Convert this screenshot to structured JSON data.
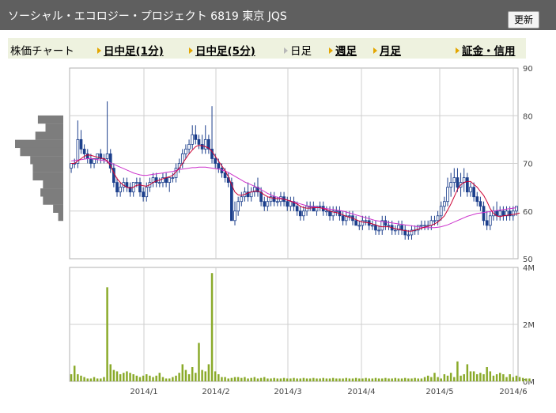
{
  "header": {
    "title": "ソーシャル・エコロジー・プロジェクト 6819 東京 JQS",
    "refresh_label": "更新"
  },
  "tabs": [
    {
      "label": "株価チャート",
      "kind": "heading"
    },
    {
      "label": "日中足(1分)",
      "kind": "link"
    },
    {
      "label": "日中足(5分)",
      "kind": "link"
    },
    {
      "label": "日足",
      "kind": "current"
    },
    {
      "label": "週足",
      "kind": "link"
    },
    {
      "label": "月足",
      "kind": "link"
    },
    {
      "label": "証金・信用",
      "kind": "link"
    }
  ],
  "colors": {
    "candle": "#1c3f8c",
    "ma_short": "#cc0033",
    "ma_long": "#cc33cc",
    "volume": "#8aaa2a",
    "profile": "#7d7d7d",
    "grid": "#cfcfcf",
    "frame": "#b0b0b0",
    "header_bg": "#5f5f5f",
    "tab_bg": "#eef2df"
  },
  "chart_data": [
    {
      "type": "candlestick",
      "yticks": [
        "90",
        "80",
        "70",
        "60",
        "50"
      ],
      "ylim": [
        50,
        90
      ],
      "xticks": [
        "2014/1",
        "2014/2",
        "2014/3",
        "2014/4",
        "2014/5",
        "2014/6"
      ],
      "candles": [
        [
          69,
          70,
          68,
          70
        ],
        [
          70,
          71,
          69,
          70
        ],
        [
          70,
          79,
          69,
          75
        ],
        [
          75,
          77,
          72,
          73
        ],
        [
          73,
          74,
          71,
          72
        ],
        [
          72,
          73,
          70,
          71
        ],
        [
          71,
          72,
          69,
          70
        ],
        [
          70,
          71,
          69,
          71
        ],
        [
          71,
          72,
          70,
          72
        ],
        [
          72,
          73,
          70,
          71
        ],
        [
          71,
          72,
          70,
          71
        ],
        [
          71,
          83,
          70,
          72
        ],
        [
          72,
          73,
          68,
          69
        ],
        [
          69,
          70,
          65,
          66
        ],
        [
          66,
          67,
          63,
          64
        ],
        [
          64,
          66,
          63,
          65
        ],
        [
          65,
          67,
          64,
          66
        ],
        [
          66,
          67,
          64,
          65
        ],
        [
          65,
          66,
          63,
          64
        ],
        [
          64,
          66,
          63,
          66
        ],
        [
          66,
          67,
          65,
          66
        ],
        [
          66,
          67,
          63,
          64
        ],
        [
          64,
          65,
          62,
          63
        ],
        [
          63,
          66,
          62,
          65
        ],
        [
          65,
          67,
          64,
          66
        ],
        [
          66,
          68,
          65,
          67
        ],
        [
          67,
          68,
          65,
          66
        ],
        [
          66,
          67,
          65,
          66
        ],
        [
          66,
          68,
          65,
          67
        ],
        [
          67,
          68,
          65,
          66
        ],
        [
          66,
          67,
          64,
          67
        ],
        [
          67,
          68,
          66,
          67
        ],
        [
          67,
          70,
          66,
          69
        ],
        [
          69,
          71,
          68,
          70
        ],
        [
          70,
          73,
          69,
          72
        ],
        [
          72,
          74,
          71,
          73
        ],
        [
          73,
          75,
          72,
          74
        ],
        [
          74,
          78,
          73,
          76
        ],
        [
          76,
          78,
          74,
          75
        ],
        [
          75,
          76,
          73,
          74
        ],
        [
          74,
          76,
          72,
          73
        ],
        [
          73,
          78,
          72,
          75
        ],
        [
          75,
          76,
          72,
          73
        ],
        [
          73,
          82,
          70,
          71
        ],
        [
          71,
          72,
          69,
          70
        ],
        [
          70,
          71,
          68,
          69
        ],
        [
          69,
          70,
          67,
          68
        ],
        [
          68,
          69,
          66,
          67
        ],
        [
          67,
          68,
          65,
          66
        ],
        [
          66,
          67,
          59,
          58
        ],
        [
          58,
          62,
          57,
          60
        ],
        [
          60,
          63,
          59,
          62
        ],
        [
          62,
          64,
          61,
          63
        ],
        [
          63,
          65,
          62,
          64
        ],
        [
          64,
          66,
          62,
          63
        ],
        [
          63,
          65,
          62,
          64
        ],
        [
          64,
          66,
          63,
          65
        ],
        [
          65,
          67,
          63,
          64
        ],
        [
          64,
          65,
          61,
          62
        ],
        [
          62,
          63,
          60,
          61
        ],
        [
          61,
          63,
          60,
          62
        ],
        [
          62,
          64,
          61,
          63
        ],
        [
          63,
          64,
          61,
          62
        ],
        [
          62,
          63,
          61,
          62
        ],
        [
          62,
          64,
          61,
          63
        ],
        [
          63,
          64,
          61,
          62
        ],
        [
          62,
          63,
          60,
          61
        ],
        [
          61,
          63,
          60,
          62
        ],
        [
          62,
          63,
          60,
          61
        ],
        [
          61,
          62,
          59,
          60
        ],
        [
          60,
          61,
          58,
          59
        ],
        [
          59,
          61,
          58,
          60
        ],
        [
          60,
          62,
          59,
          61
        ],
        [
          61,
          62,
          60,
          61
        ],
        [
          61,
          62,
          60,
          60
        ],
        [
          60,
          61,
          59,
          61
        ],
        [
          61,
          62,
          60,
          61
        ],
        [
          61,
          62,
          59,
          60
        ],
        [
          60,
          61,
          59,
          60
        ],
        [
          60,
          61,
          58,
          59
        ],
        [
          59,
          61,
          58,
          60
        ],
        [
          60,
          61,
          59,
          60
        ],
        [
          60,
          61,
          58,
          59
        ],
        [
          59,
          60,
          57,
          58
        ],
        [
          58,
          60,
          57,
          59
        ],
        [
          59,
          60,
          58,
          59
        ],
        [
          59,
          60,
          57,
          58
        ],
        [
          58,
          59,
          57,
          57
        ],
        [
          57,
          58,
          56,
          57
        ],
        [
          57,
          59,
          56,
          58
        ],
        [
          58,
          59,
          57,
          58
        ],
        [
          58,
          59,
          56,
          57
        ],
        [
          57,
          58,
          56,
          57
        ],
        [
          57,
          58,
          55,
          56
        ],
        [
          56,
          57,
          55,
          56
        ],
        [
          56,
          59,
          55,
          58
        ],
        [
          58,
          59,
          56,
          57
        ],
        [
          57,
          58,
          56,
          57
        ],
        [
          57,
          58,
          55,
          56
        ],
        [
          56,
          57,
          55,
          56
        ],
        [
          56,
          58,
          55,
          57
        ],
        [
          57,
          58,
          55,
          56
        ],
        [
          56,
          57,
          54,
          55
        ],
        [
          55,
          56,
          54,
          55
        ],
        [
          55,
          57,
          54,
          56
        ],
        [
          56,
          57,
          55,
          56
        ],
        [
          56,
          57,
          55,
          57
        ],
        [
          57,
          58,
          56,
          57
        ],
        [
          57,
          58,
          56,
          57
        ],
        [
          57,
          58,
          56,
          57
        ],
        [
          57,
          59,
          56,
          58
        ],
        [
          58,
          59,
          57,
          58
        ],
        [
          58,
          60,
          57,
          59
        ],
        [
          59,
          62,
          58,
          61
        ],
        [
          61,
          63,
          60,
          62
        ],
        [
          62,
          67,
          61,
          65
        ],
        [
          65,
          68,
          63,
          66
        ],
        [
          66,
          69,
          64,
          67
        ],
        [
          67,
          69,
          64,
          65
        ],
        [
          65,
          68,
          63,
          66
        ],
        [
          66,
          69,
          64,
          67
        ],
        [
          67,
          68,
          63,
          64
        ],
        [
          64,
          66,
          63,
          65
        ],
        [
          65,
          66,
          62,
          63
        ],
        [
          63,
          64,
          61,
          62
        ],
        [
          62,
          63,
          60,
          61
        ],
        [
          61,
          62,
          57,
          58
        ],
        [
          58,
          60,
          56,
          57
        ],
        [
          57,
          60,
          56,
          59
        ],
        [
          59,
          61,
          58,
          60
        ],
        [
          60,
          62,
          58,
          59
        ],
        [
          59,
          61,
          58,
          60
        ],
        [
          60,
          61,
          58,
          59
        ],
        [
          59,
          61,
          58,
          60
        ],
        [
          60,
          61,
          58,
          59
        ],
        [
          59,
          61,
          58,
          60
        ],
        [
          60,
          61,
          59,
          61
        ]
      ],
      "ma_short": [
        70,
        70,
        70.5,
        71,
        71.5,
        71.8,
        71.7,
        71.5,
        71.3,
        71.1,
        71,
        70.5,
        69.5,
        68,
        66.8,
        66,
        65.4,
        65,
        64.8,
        65,
        65.4,
        65.5,
        65.3,
        65.2,
        65.5,
        66,
        66.3,
        66.5,
        66.8,
        67,
        67.2,
        67.5,
        68.2,
        69,
        70,
        71,
        72,
        72.8,
        73.5,
        73.8,
        73.7,
        73.5,
        73.2,
        72.5,
        71.5,
        70.5,
        69.5,
        68.5,
        67.2,
        65.5,
        64,
        63.4,
        63.3,
        63.5,
        63.8,
        64,
        64.2,
        64.2,
        63.9,
        63.4,
        63,
        62.8,
        62.7,
        62.6,
        62.6,
        62.5,
        62.3,
        62.1,
        61.8,
        61.5,
        61,
        60.7,
        60.6,
        60.6,
        60.7,
        60.7,
        60.7,
        60.5,
        60.3,
        60,
        59.8,
        59.7,
        59.5,
        59.2,
        58.9,
        58.7,
        58.5,
        58.2,
        57.9,
        57.7,
        57.6,
        57.5,
        57.3,
        57.1,
        56.8,
        56.7,
        56.7,
        56.7,
        56.5,
        56.3,
        56.2,
        56,
        55.9,
        55.8,
        55.8,
        56,
        56.2,
        56.4,
        56.6,
        56.8,
        57,
        57.3,
        57.7,
        58.3,
        59,
        60.2,
        61.5,
        63,
        64.5,
        65.5,
        66,
        66.2,
        66.2,
        65.6,
        65,
        64.1,
        63.3,
        62,
        60.5,
        59.5,
        59,
        58.8,
        59,
        59.1,
        59.2,
        59.3,
        59.4,
        59.6
      ],
      "ma_long": [
        70.5,
        70.6,
        70.7,
        70.8,
        70.9,
        71,
        71,
        70.9,
        70.8,
        70.7,
        70.6,
        70.4,
        70.1,
        69.8,
        69.5,
        69.2,
        68.9,
        68.6,
        68.3,
        68,
        67.8,
        67.6,
        67.5,
        67.5,
        67.6,
        67.7,
        67.8,
        67.9,
        68,
        68.1,
        68.2,
        68.3,
        68.5,
        68.7,
        68.8,
        68.9,
        69,
        69.1,
        69.1,
        69.2,
        69.2,
        69.2,
        69.1,
        69,
        68.9,
        68.8,
        68.6,
        68.4,
        68.1,
        67.7,
        67.3,
        66.9,
        66.5,
        66.1,
        65.8,
        65.5,
        65.2,
        64.9,
        64.5,
        64.1,
        63.7,
        63.4,
        63.1,
        62.9,
        62.7,
        62.5,
        62.3,
        62.1,
        61.9,
        61.7,
        61.5,
        61.3,
        61.1,
        61,
        60.9,
        60.8,
        60.7,
        60.6,
        60.5,
        60.4,
        60.3,
        60.2,
        60.1,
        60,
        59.8,
        59.6,
        59.4,
        59.2,
        59,
        58.8,
        58.6,
        58.4,
        58.2,
        58,
        57.9,
        57.8,
        57.7,
        57.6,
        57.5,
        57.4,
        57.3,
        57.2,
        57.1,
        57,
        56.9,
        56.8,
        56.7,
        56.6,
        56.5,
        56.5,
        56.5,
        56.5,
        56.6,
        56.7,
        56.9,
        57.1,
        57.4,
        57.7,
        58,
        58.3,
        58.6,
        58.9,
        59.1,
        59.3,
        59.5,
        59.6,
        59.7,
        59.8,
        59.9,
        60,
        60.1,
        60.2,
        60.3,
        60.4,
        60.5,
        60.6,
        60.7
      ]
    },
    {
      "type": "bar",
      "yticks": [
        "4M",
        "2M",
        "0M"
      ],
      "ylim": [
        0,
        4
      ],
      "values": [
        0.25,
        0.55,
        0.25,
        0.2,
        0.15,
        0.1,
        0.1,
        0.15,
        0.1,
        0.1,
        0.15,
        3.3,
        0.6,
        0.4,
        0.35,
        0.25,
        0.3,
        0.35,
        0.3,
        0.25,
        0.2,
        0.15,
        0.2,
        0.25,
        0.2,
        0.15,
        0.2,
        0.3,
        0.15,
        0.1,
        0.1,
        0.15,
        0.2,
        0.3,
        0.6,
        0.4,
        0.25,
        0.5,
        0.3,
        1.35,
        0.4,
        0.35,
        0.6,
        3.8,
        0.35,
        0.25,
        0.15,
        0.15,
        0.1,
        0.12,
        0.15,
        0.15,
        0.12,
        0.15,
        0.1,
        0.12,
        0.15,
        0.1,
        0.12,
        0.15,
        0.1,
        0.1,
        0.12,
        0.1,
        0.1,
        0.12,
        0.1,
        0.1,
        0.12,
        0.1,
        0.1,
        0.12,
        0.1,
        0.1,
        0.12,
        0.1,
        0.1,
        0.12,
        0.1,
        0.1,
        0.12,
        0.1,
        0.1,
        0.1,
        0.12,
        0.1,
        0.1,
        0.12,
        0.1,
        0.1,
        0.12,
        0.1,
        0.1,
        0.12,
        0.1,
        0.1,
        0.12,
        0.1,
        0.1,
        0.12,
        0.1,
        0.1,
        0.12,
        0.1,
        0.1,
        0.12,
        0.1,
        0.1,
        0.15,
        0.2,
        0.15,
        0.3,
        0.15,
        0.1,
        0.25,
        0.2,
        0.3,
        0.15,
        0.7,
        0.2,
        0.25,
        0.6,
        0.35,
        0.35,
        0.25,
        0.3,
        0.25,
        0.5,
        0.35,
        0.2,
        0.25,
        0.3,
        0.25,
        0.15,
        0.25,
        0.15,
        0.2,
        0.15,
        0.12,
        0.1,
        0.1
      ]
    }
  ],
  "price_profile": [
    0.1,
    0.07,
    0.11,
    0.19,
    0.17,
    0.13,
    0.12,
    0.12,
    0.08,
    0.09,
    0.08,
    0.04,
    0.02
  ]
}
